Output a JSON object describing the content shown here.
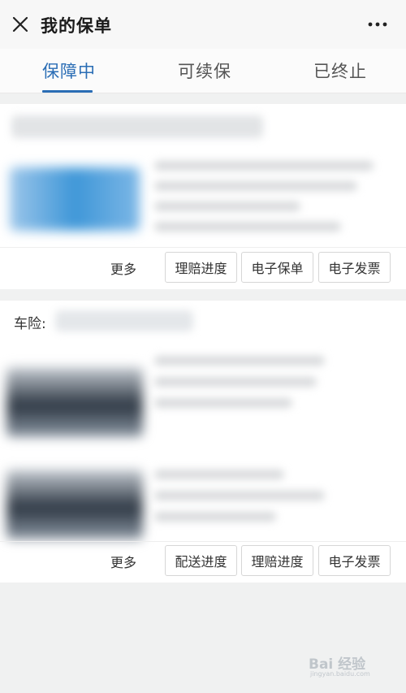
{
  "header": {
    "title": "我的保单",
    "close_icon": "close-icon",
    "more_icon": "more-dots-icon"
  },
  "tabs": [
    {
      "label": "保障中",
      "active": true
    },
    {
      "label": "可续保",
      "active": false
    },
    {
      "label": "已终止",
      "active": false
    }
  ],
  "colors": {
    "accent": "#2a6db5",
    "background": "#f0f1f1"
  },
  "policies": [
    {
      "section_label": "",
      "actions": {
        "more": "更多",
        "buttons": [
          "理赔进度",
          "电子保单",
          "电子发票"
        ]
      }
    },
    {
      "section_label": "车险:",
      "actions": {
        "more": "更多",
        "buttons": [
          "配送进度",
          "理赔进度",
          "电子发票"
        ]
      }
    }
  ],
  "watermark": {
    "text": "Bai 经验",
    "sub": "jingyan.baidu.com"
  }
}
